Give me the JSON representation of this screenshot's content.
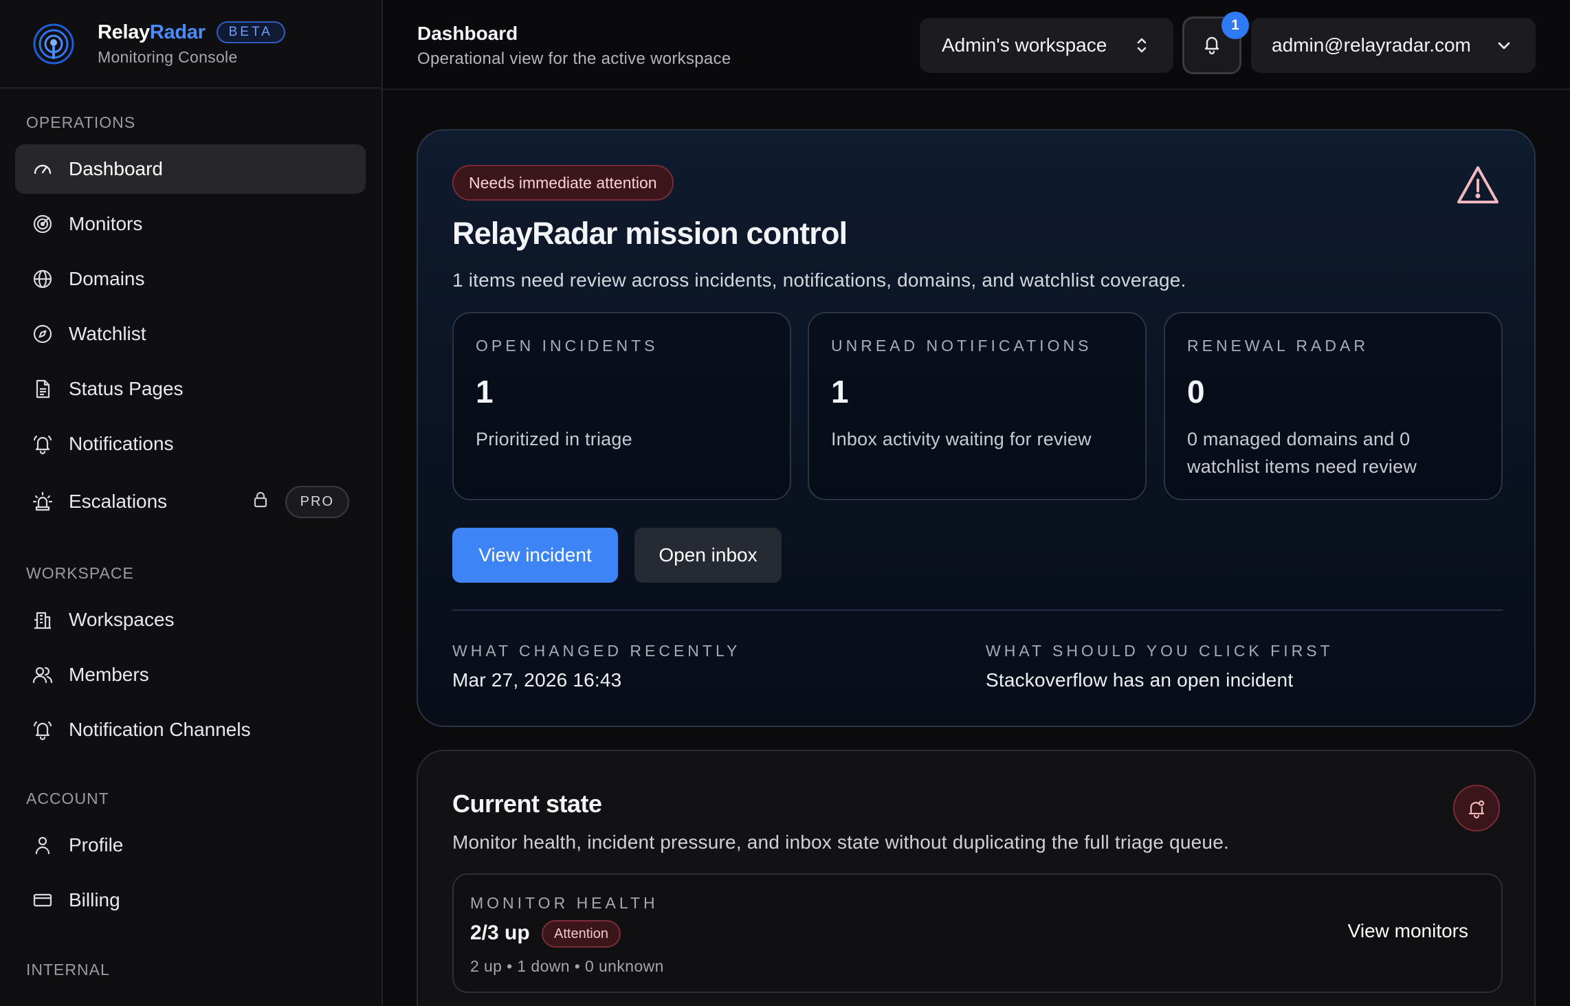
{
  "brand": {
    "name_part1": "Relay",
    "name_part2": "Radar",
    "beta": "BETA",
    "subtitle": "Monitoring Console",
    "accent": "#4a8cff"
  },
  "sidebar": {
    "sections": [
      {
        "label": "OPERATIONS",
        "items": [
          {
            "label": "Dashboard",
            "icon": "gauge-icon",
            "active": true
          },
          {
            "label": "Monitors",
            "icon": "radar-icon"
          },
          {
            "label": "Domains",
            "icon": "globe-icon"
          },
          {
            "label": "Watchlist",
            "icon": "compass-icon"
          },
          {
            "label": "Status Pages",
            "icon": "document-icon"
          },
          {
            "label": "Notifications",
            "icon": "bell-ring-icon"
          },
          {
            "label": "Escalations",
            "icon": "siren-icon",
            "badge": "PRO",
            "locked": true
          }
        ]
      },
      {
        "label": "WORKSPACE",
        "items": [
          {
            "label": "Workspaces",
            "icon": "building-icon"
          },
          {
            "label": "Members",
            "icon": "users-icon"
          },
          {
            "label": "Notification Channels",
            "icon": "bell-ring-icon"
          }
        ]
      },
      {
        "label": "ACCOUNT",
        "items": [
          {
            "label": "Profile",
            "icon": "user-icon"
          },
          {
            "label": "Billing",
            "icon": "credit-card-icon"
          }
        ]
      },
      {
        "label": "INTERNAL",
        "items": []
      }
    ]
  },
  "header": {
    "title": "Dashboard",
    "subtitle": "Operational view for the active workspace",
    "workspace": "Admin's workspace",
    "notification_count": "1",
    "user": "admin@relayradar.com"
  },
  "hero": {
    "alert": "Needs immediate attention",
    "title": "RelayRadar mission control",
    "description": "1 items need review across incidents, notifications, domains, and watchlist coverage.",
    "stats": [
      {
        "label": "OPEN INCIDENTS",
        "value": "1",
        "note": "Prioritized in triage"
      },
      {
        "label": "UNREAD NOTIFICATIONS",
        "value": "1",
        "note": "Inbox activity waiting for review"
      },
      {
        "label": "RENEWAL RADAR",
        "value": "0",
        "note": "0 managed domains and 0 watchlist items need review"
      }
    ],
    "primary_button": "View incident",
    "secondary_button": "Open inbox",
    "changed_label": "WHAT CHANGED RECENTLY",
    "changed_value": "Mar 27, 2026 16:43",
    "click_label": "WHAT SHOULD YOU CLICK FIRST",
    "click_value": "Stackoverflow has an open incident"
  },
  "current_state": {
    "title": "Current state",
    "description": "Monitor health, incident pressure, and inbox state without duplicating the full triage queue.",
    "monitor_health": {
      "label": "MONITOR HEALTH",
      "value": "2/3 up",
      "badge": "Attention",
      "summary": "2 up • 1 down • 0 unknown",
      "link": "View monitors"
    }
  },
  "colors": {
    "primary": "#3d85f6",
    "danger_bg": "#3a1519",
    "danger_border": "#7b2c36"
  }
}
